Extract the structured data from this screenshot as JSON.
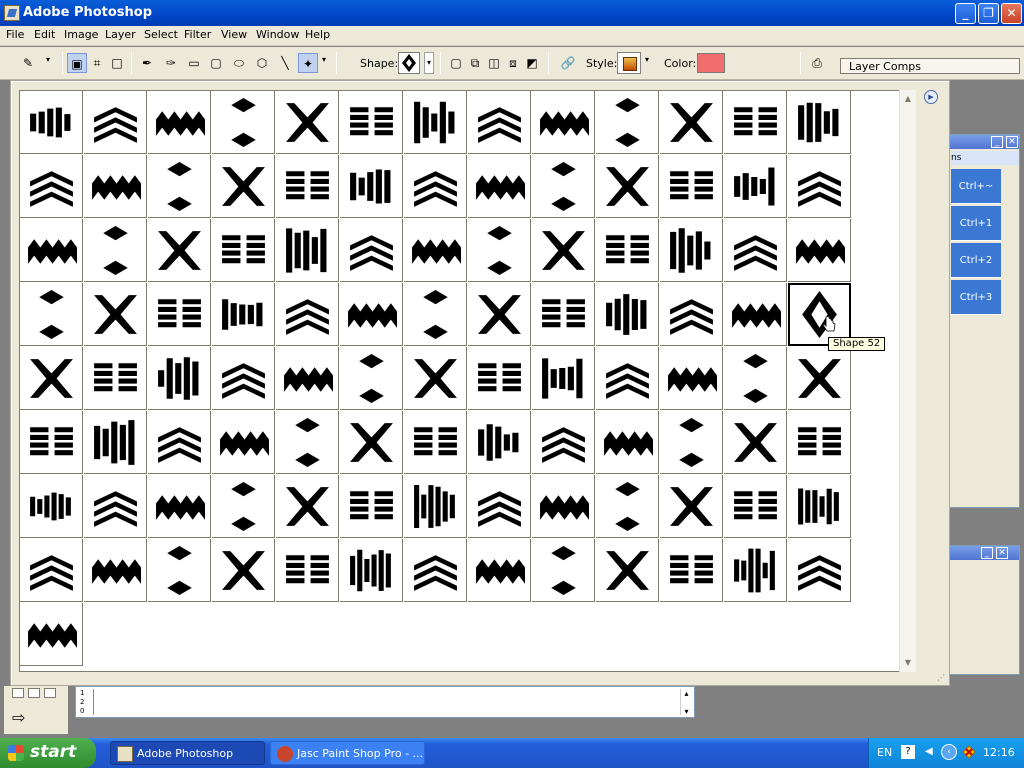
{
  "window": {
    "title": "Adobe Photoshop"
  },
  "menu": [
    "File",
    "Edit",
    "Image",
    "Layer",
    "Select",
    "Filter",
    "View",
    "Window",
    "Help"
  ],
  "options": {
    "shape_label": "Shape:",
    "style_label": "Style:",
    "color_label": "Color:",
    "color_value": "#f06e6e"
  },
  "layer_comps": {
    "label": "Layer Comps"
  },
  "history": {
    "items": [
      "Ctrl+~",
      "Ctrl+1",
      "Ctrl+2",
      "Ctrl+3"
    ],
    "tab_fragment": "ns"
  },
  "popup": {
    "tooltip": "Shape 52",
    "selected_index": 51,
    "shape_count": 105
  },
  "taskbar": {
    "start": "start",
    "tasks": [
      "Adobe Photoshop",
      "Jasc Paint Shop Pro - ..."
    ],
    "lang": "EN",
    "clock": "12:16"
  }
}
